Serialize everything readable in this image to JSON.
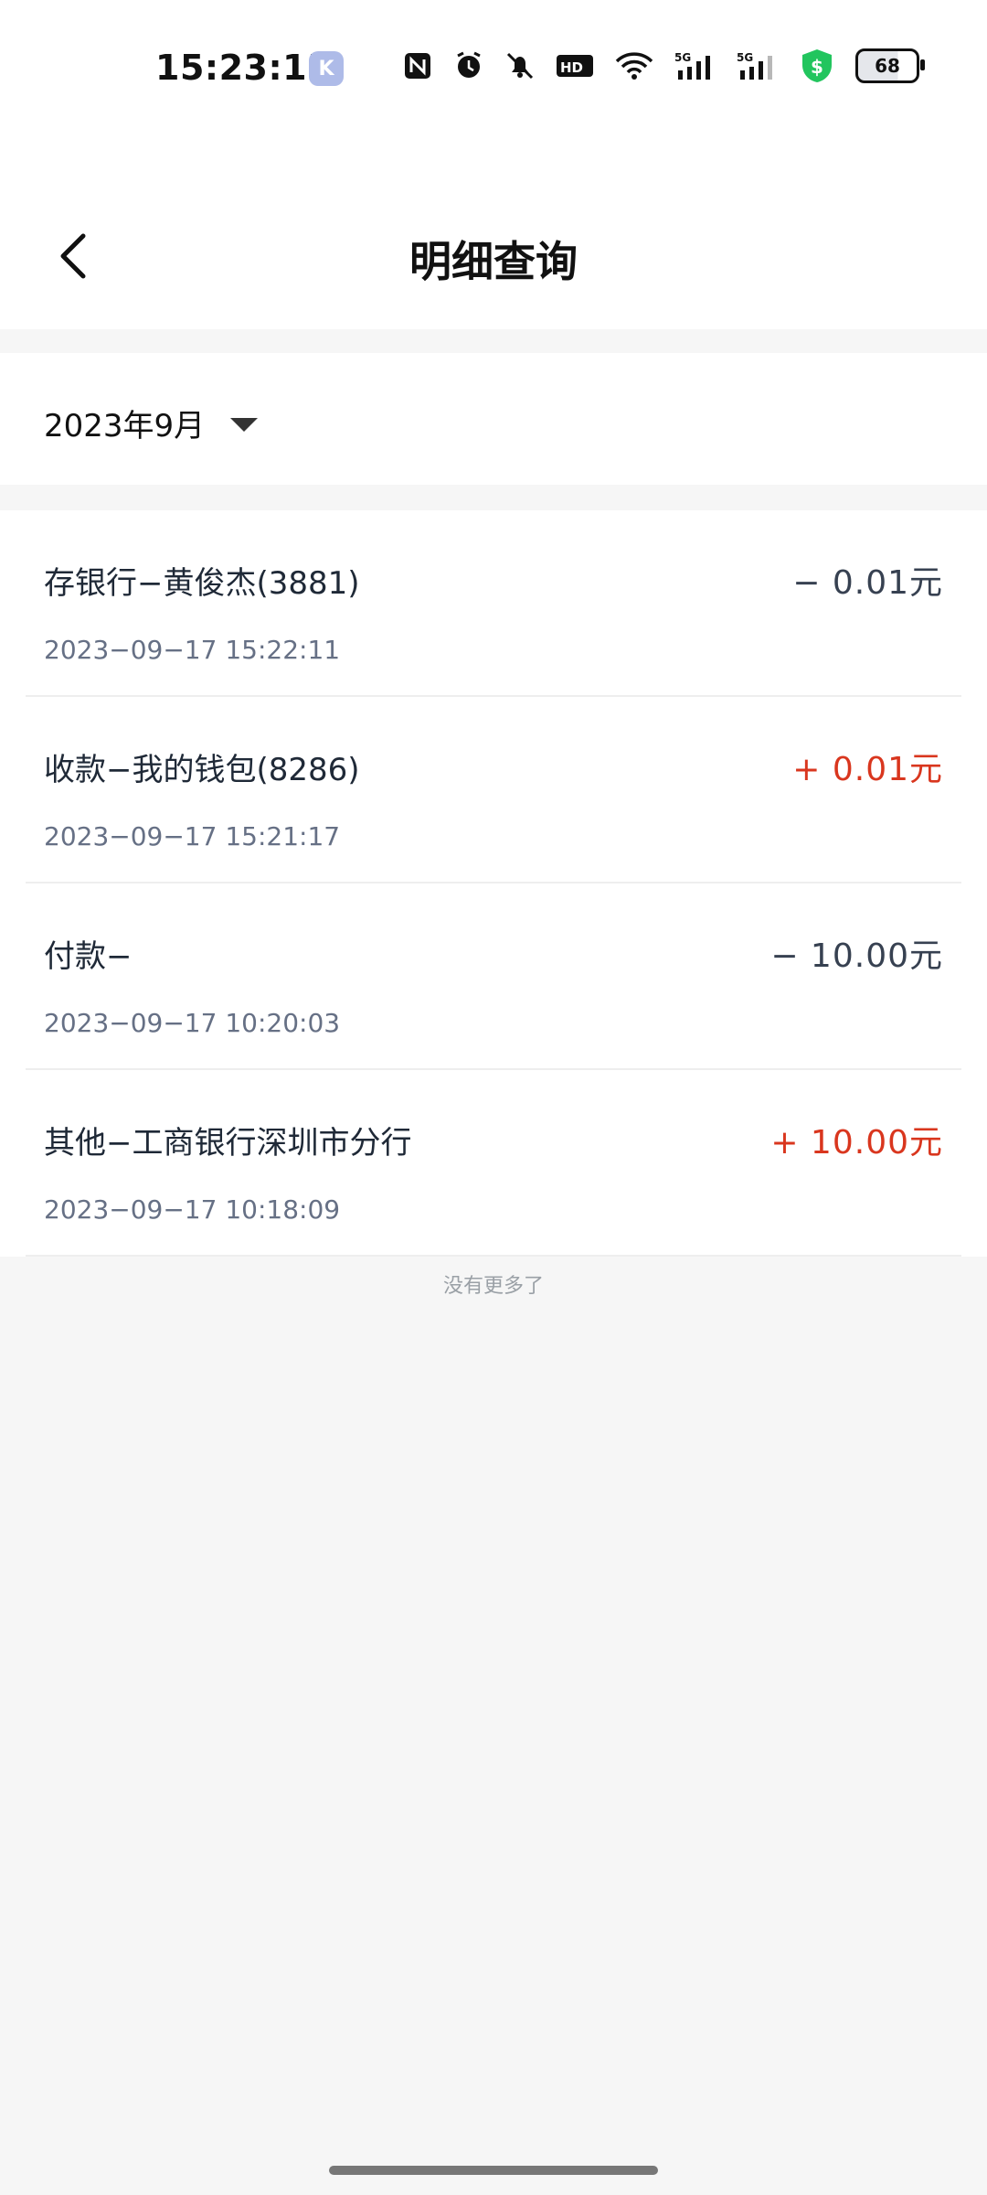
{
  "status_bar": {
    "time": "15:23:15",
    "app_icon_letter": "K",
    "battery": "68",
    "signal_label": "5G"
  },
  "header": {
    "title": "明细查询"
  },
  "filter": {
    "month": "2023年9月"
  },
  "transactions": [
    {
      "title": "存银行−黄俊杰(3881)",
      "date": "2023−09−17 15:22:11",
      "amount": "− 0.01元",
      "type": "negative"
    },
    {
      "title": "收款−我的钱包(8286)",
      "date": "2023−09−17 15:21:17",
      "amount": "+ 0.01元",
      "type": "positive"
    },
    {
      "title": "付款−",
      "date": "2023−09−17 10:20:03",
      "amount": "− 10.00元",
      "type": "negative"
    },
    {
      "title": "其他−工商银行深圳市分行",
      "date": "2023−09−17 10:18:09",
      "amount": "+ 10.00元",
      "type": "positive"
    }
  ],
  "footer": {
    "no_more": "没有更多了"
  },
  "colors": {
    "positive": "#d9361e",
    "negative": "#374151",
    "background": "#f6f6f6"
  }
}
